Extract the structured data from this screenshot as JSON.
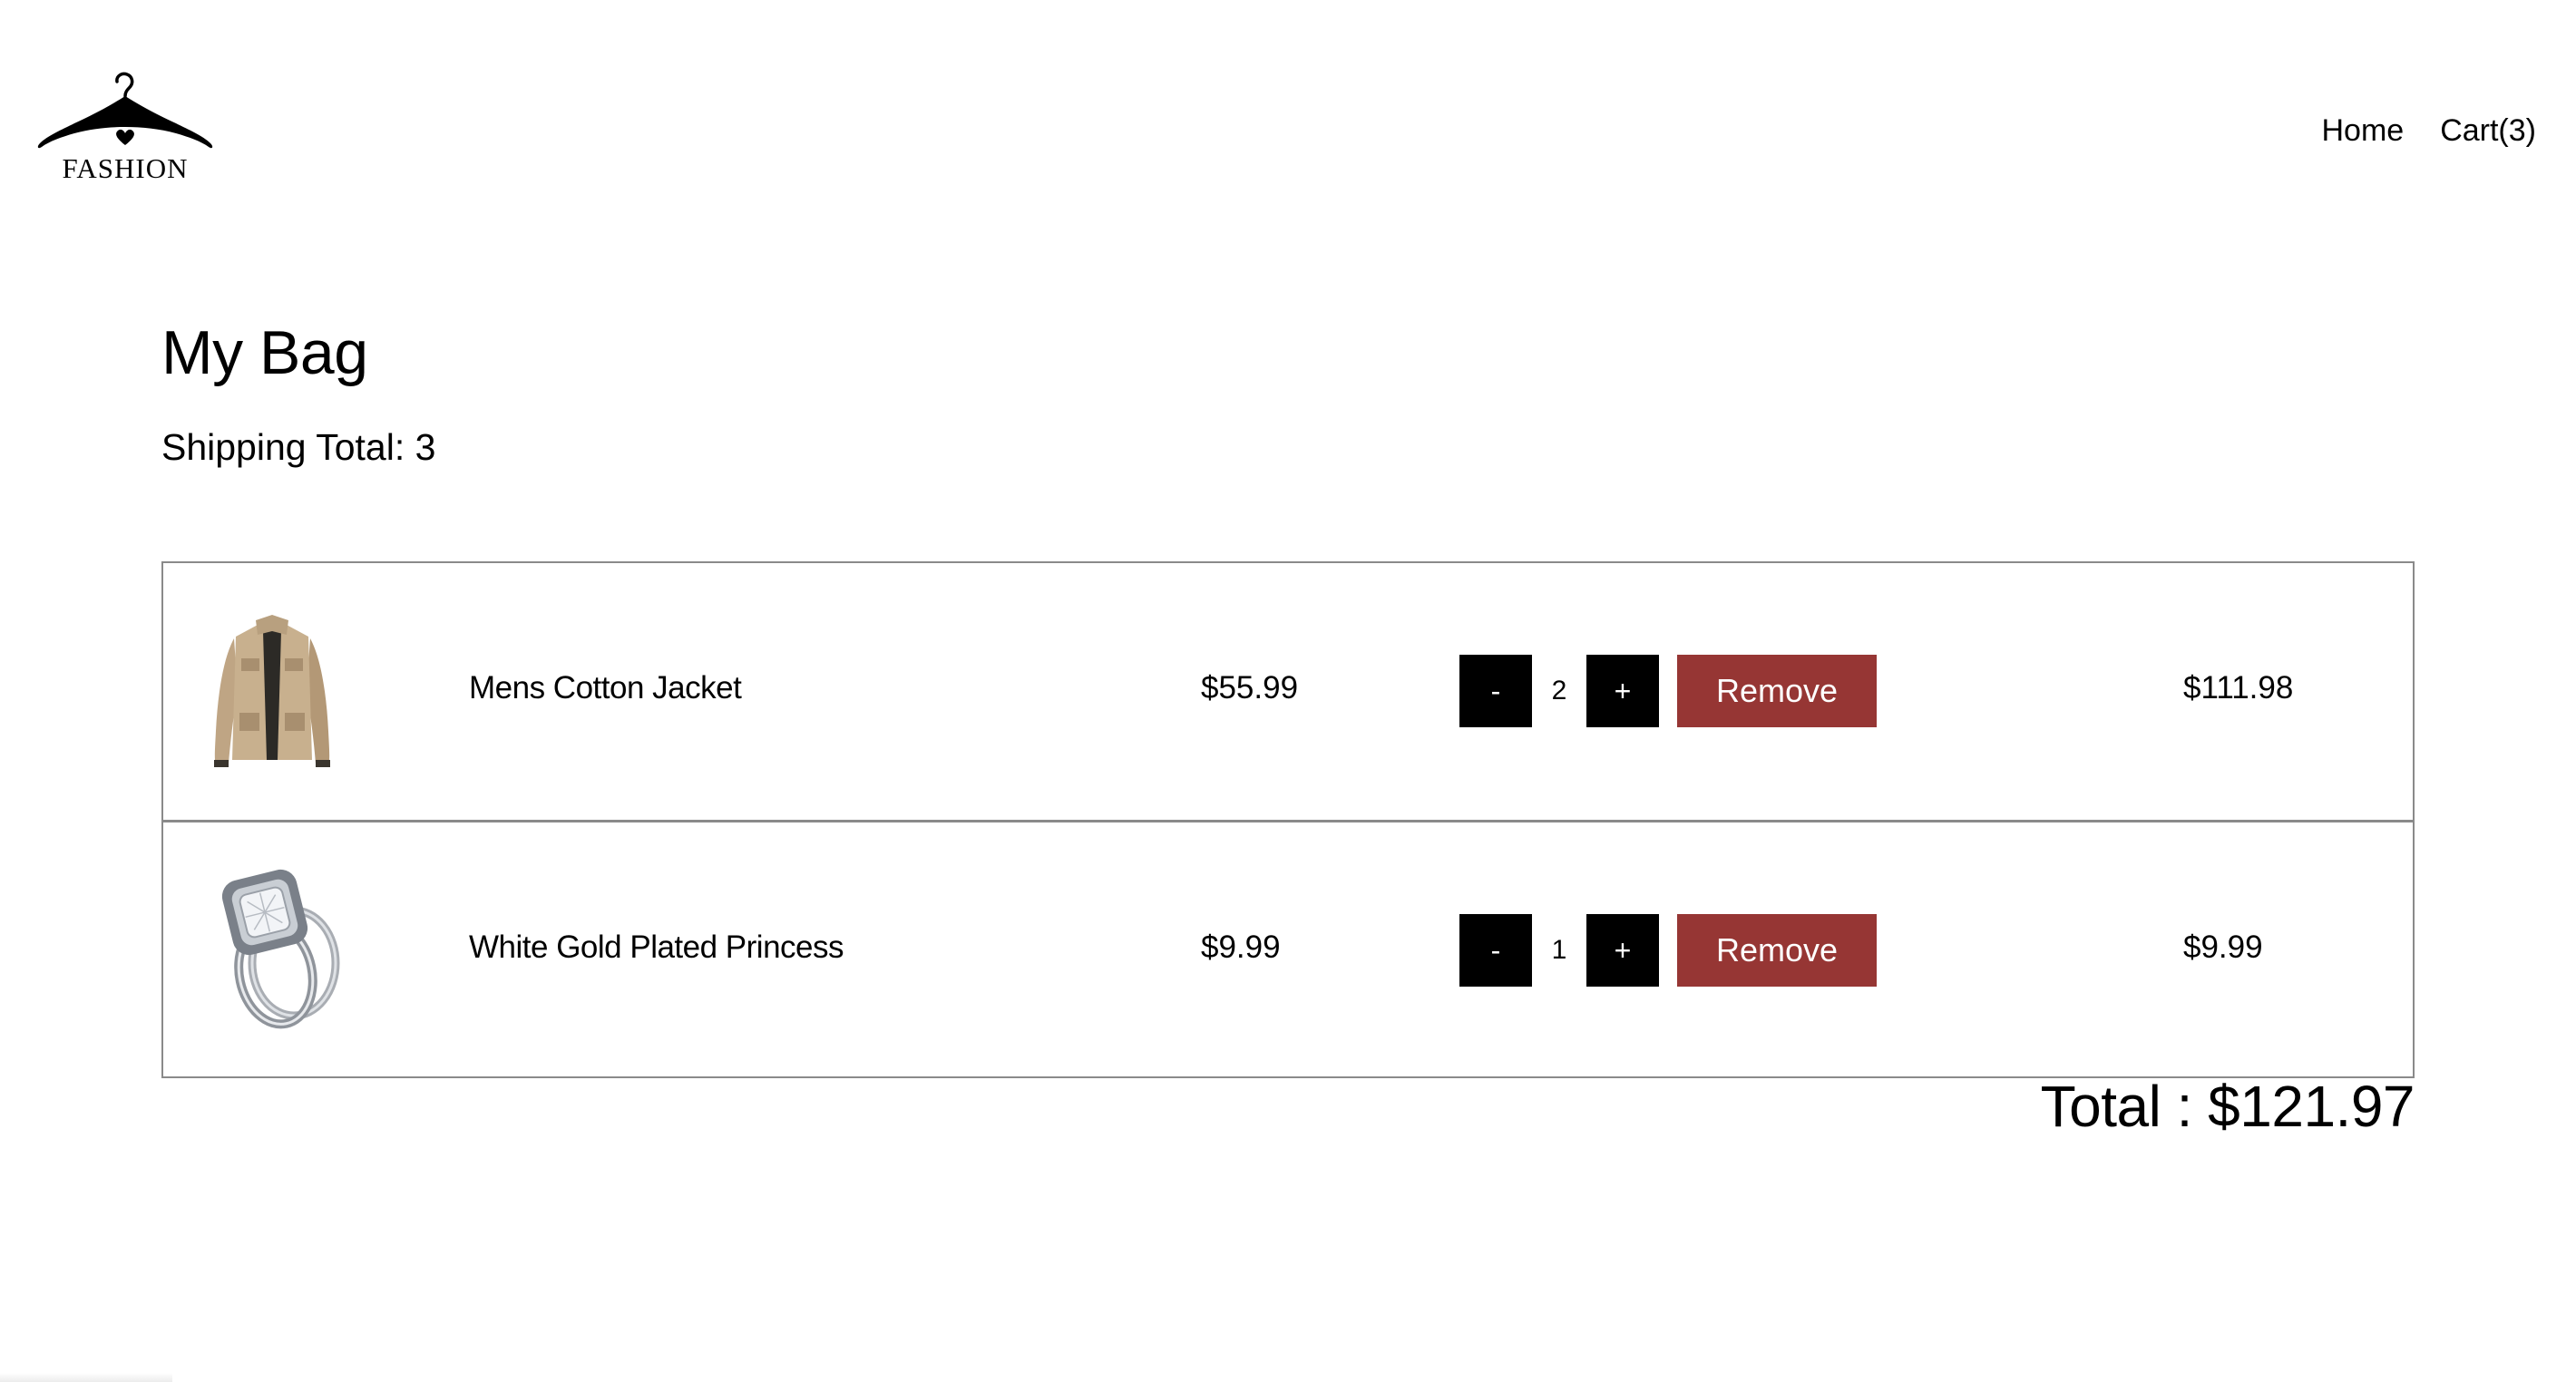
{
  "header": {
    "logo_text": "FASHION",
    "nav": {
      "home": "Home",
      "cart": "Cart(3)"
    }
  },
  "main": {
    "title": "My Bag",
    "shipping_total": "Shipping Total: 3"
  },
  "cart": {
    "items": [
      {
        "name": "Mens Cotton Jacket",
        "price": "$55.99",
        "quantity": "2",
        "minus_label": "-",
        "plus_label": "+",
        "remove_label": "Remove",
        "line_total": "$111.98",
        "image_icon": "jacket-image"
      },
      {
        "name": "White Gold Plated Princess",
        "price": "$9.99",
        "quantity": "1",
        "minus_label": "-",
        "plus_label": "+",
        "remove_label": "Remove",
        "line_total": "$9.99",
        "image_icon": "ring-image"
      }
    ],
    "total": "Total : $121.97"
  },
  "colors": {
    "remove_button": "#963634",
    "qty_button": "#000000",
    "border": "#8a8a8a"
  }
}
